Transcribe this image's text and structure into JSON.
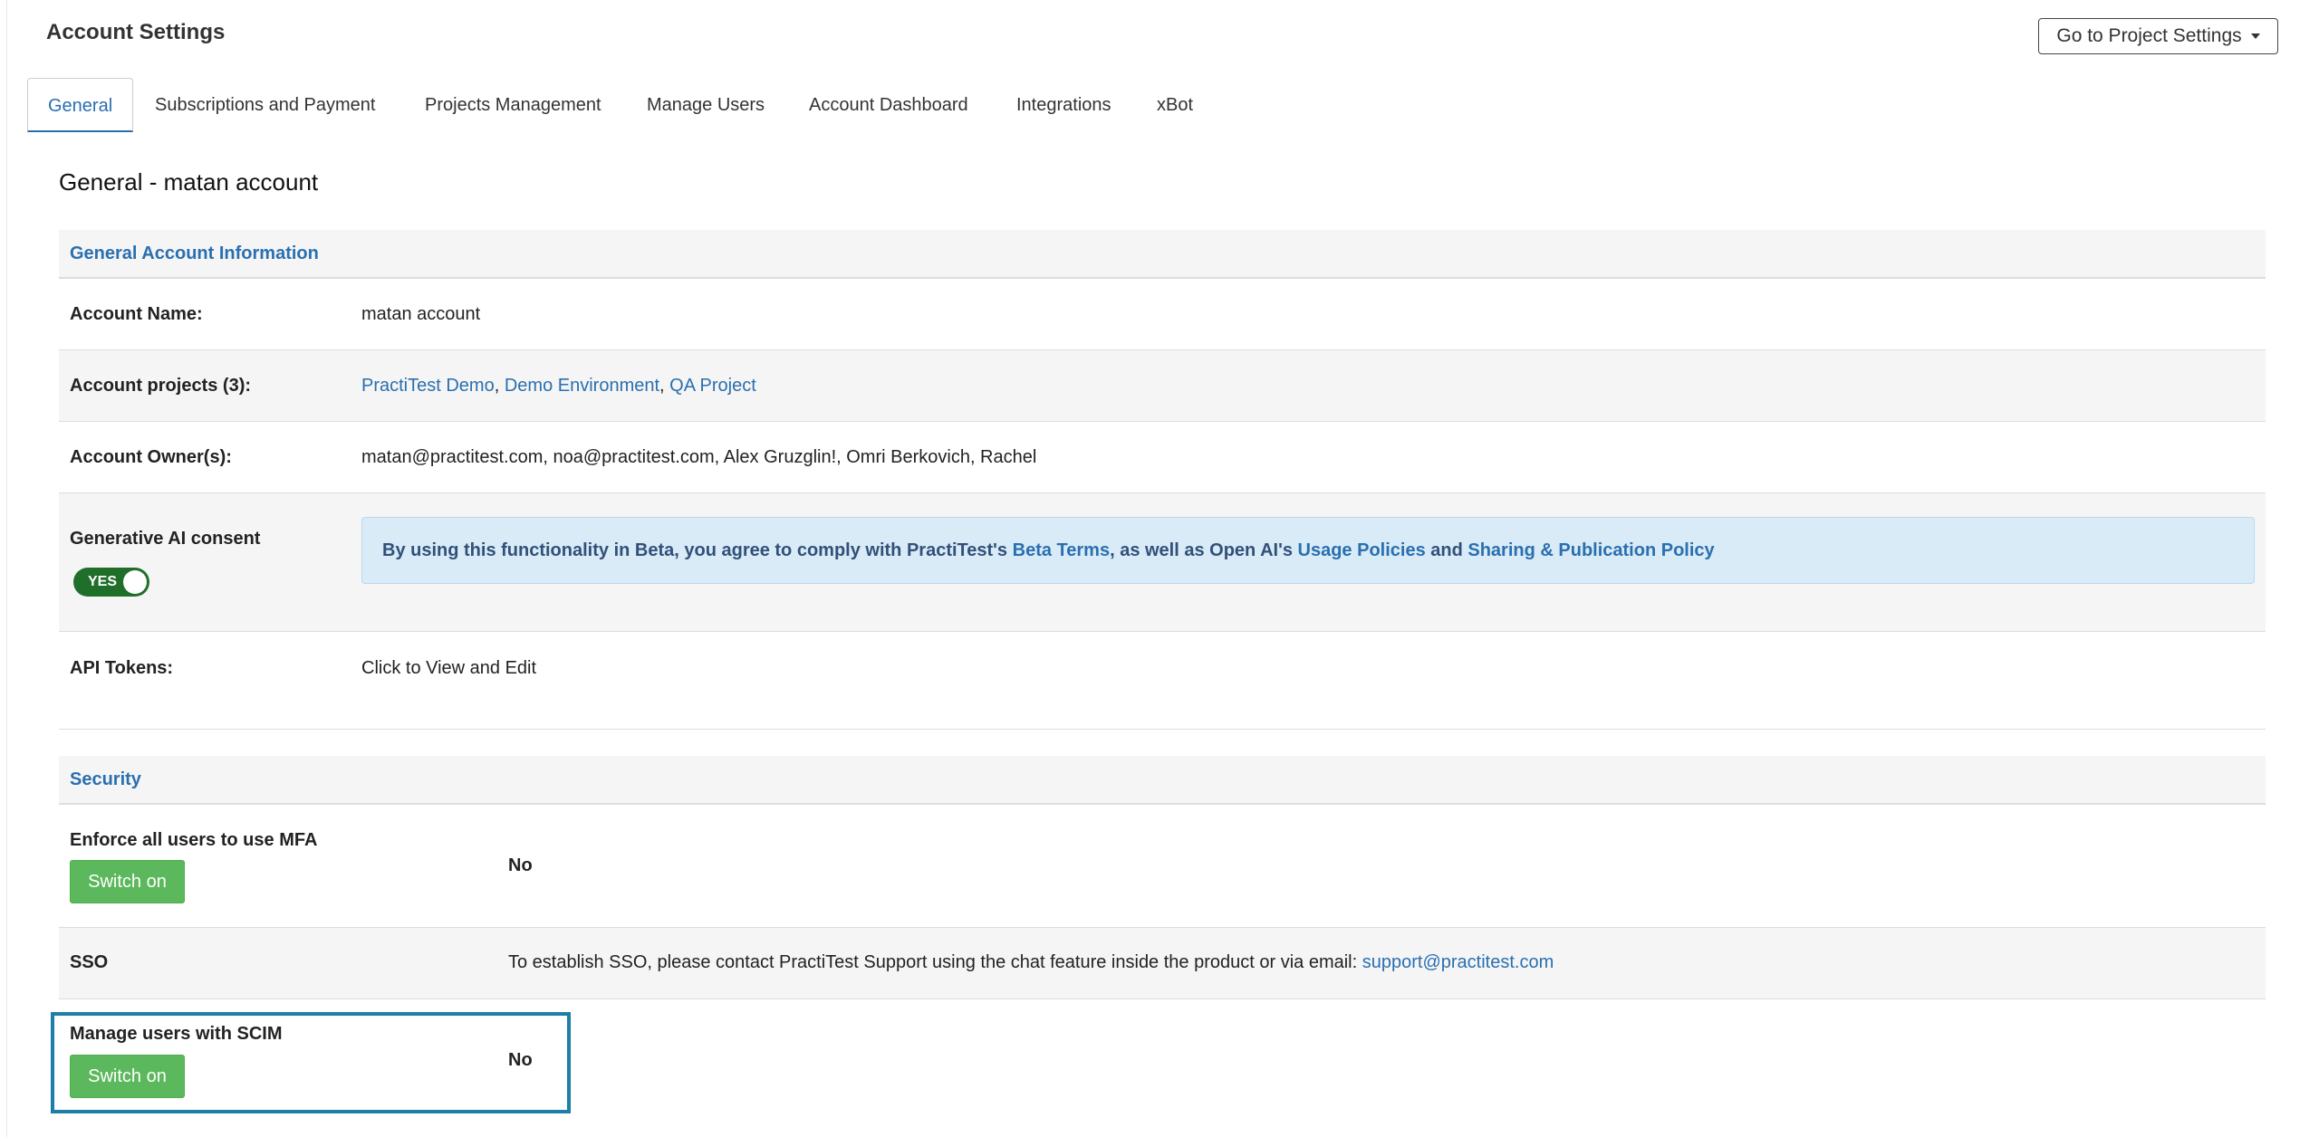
{
  "header": {
    "title": "Account Settings",
    "project_settings_button": "Go to Project Settings"
  },
  "tabs": [
    {
      "label": "General",
      "active": true
    },
    {
      "label": "Subscriptions and Payment"
    },
    {
      "label": "Projects Management"
    },
    {
      "label": "Manage Users"
    },
    {
      "label": "Account Dashboard"
    },
    {
      "label": "Integrations"
    },
    {
      "label": "xBot"
    }
  ],
  "page_heading": "General - matan account",
  "general_info": {
    "title": "General Account Information",
    "account_name": {
      "label": "Account Name:",
      "value": "matan account"
    },
    "account_projects": {
      "label": "Account projects (3):",
      "projects": [
        "PractiTest Demo",
        "Demo Environment",
        "QA Project"
      ],
      "separator": ", "
    },
    "account_owners": {
      "label": "Account Owner(s):",
      "value": "matan@practitest.com, noa@practitest.com, Alex Gruzglin!, Omri Berkovich, Rachel"
    },
    "generative_ai": {
      "label": "Generative AI consent",
      "toggle": "YES",
      "notice": {
        "text1": "By using this functionality in Beta, you agree to comply with PractiTest's ",
        "link1": "Beta Terms",
        "text2": ", as well as Open AI's ",
        "link2": "Usage Policies",
        "text3": " and ",
        "link3": "Sharing & Publication Policy"
      }
    },
    "api_tokens": {
      "label": "API Tokens:",
      "link": "Click to View and Edit"
    }
  },
  "security": {
    "title": "Security",
    "mfa": {
      "label": "Enforce all users to use MFA",
      "button": "Switch on",
      "status": "No"
    },
    "sso": {
      "label": "SSO",
      "text": "To establish SSO, please contact PractiTest Support using the chat feature inside the product or via email: ",
      "email": "support@practitest.com"
    },
    "scim": {
      "label": "Manage users with SCIM",
      "button": "Switch on",
      "status": "No"
    }
  },
  "colors": {
    "accent": "#2a6fb0",
    "green": "#5cb85c",
    "toggle": "#1f6f2a",
    "highlight": "#1d7ea8"
  }
}
